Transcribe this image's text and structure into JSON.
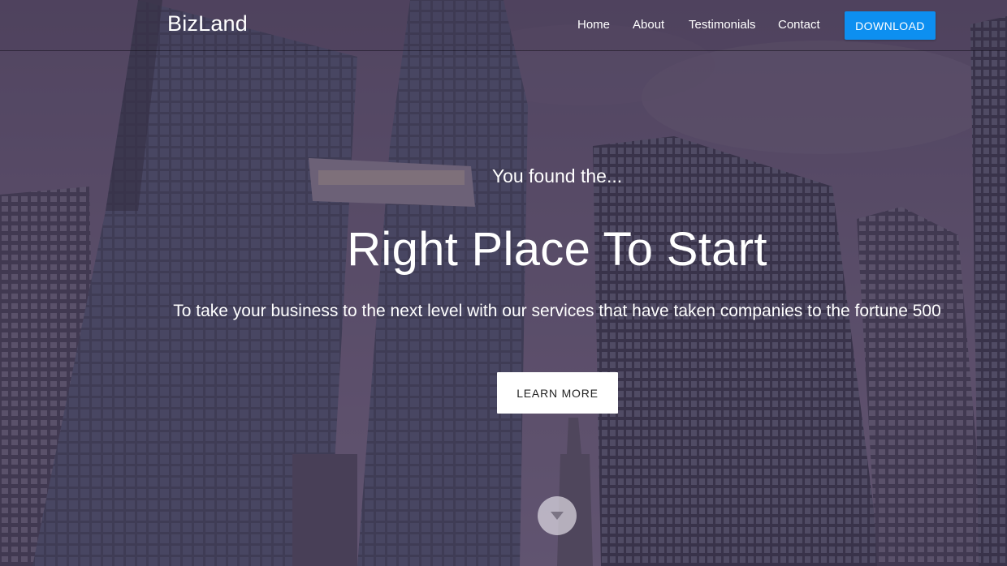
{
  "brand": {
    "name": "BizLand"
  },
  "nav": {
    "items": [
      {
        "label": "Home"
      },
      {
        "label": "About"
      },
      {
        "label": "Testimonials"
      },
      {
        "label": "Contact"
      }
    ],
    "cta_label": "DOWNLOAD"
  },
  "hero": {
    "eyebrow": "You found the...",
    "headline": "Right Place To Start",
    "subtext": "To take your business to the next level with our services that have taken companies to the fortune 500",
    "button_label": "LEARN MORE",
    "scroll_icon": "chevron-down-icon"
  },
  "colors": {
    "accent": "#0d8ff0",
    "overlay": "#483a58",
    "text": "#ffffff"
  }
}
